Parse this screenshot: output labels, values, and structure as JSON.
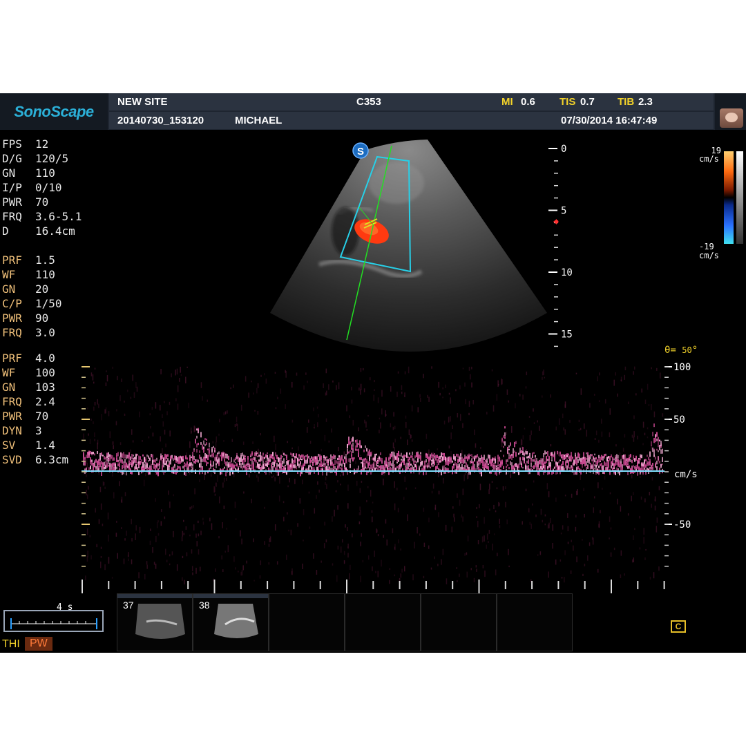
{
  "header": {
    "brand": "SonoScape",
    "site": "NEW SITE",
    "probe": "C353",
    "mi_label": "MI",
    "mi_value": "0.6",
    "tis_label": "TIS",
    "tis_value": "0.7",
    "tib_label": "TIB",
    "tib_value": "2.3",
    "exam_id": "20140730_153120",
    "patient": "MICHAEL",
    "datetime": "07/30/2014 16:47:49"
  },
  "params_bmode": [
    {
      "k": "FPS",
      "v": "12"
    },
    {
      "k": "D/G",
      "v": "120/5"
    },
    {
      "k": "GN",
      "v": "110"
    },
    {
      "k": "I/P",
      "v": "0/10"
    },
    {
      "k": "PWR",
      "v": "70"
    },
    {
      "k": "FRQ",
      "v": "3.6-5.1"
    },
    {
      "k": "D",
      "v": "16.4cm"
    }
  ],
  "params_color": [
    {
      "k": "PRF",
      "v": "1.5"
    },
    {
      "k": "WF",
      "v": "110"
    },
    {
      "k": "GN",
      "v": "20"
    },
    {
      "k": "C/P",
      "v": "1/50"
    },
    {
      "k": "PWR",
      "v": "90"
    },
    {
      "k": "FRQ",
      "v": "3.0"
    }
  ],
  "params_pw": [
    {
      "k": "PRF",
      "v": "4.0"
    },
    {
      "k": "WF",
      "v": "100"
    },
    {
      "k": "GN",
      "v": "103"
    },
    {
      "k": "FRQ",
      "v": "2.4"
    },
    {
      "k": "PWR",
      "v": "70"
    },
    {
      "k": "DYN",
      "v": "3"
    },
    {
      "k": "SV",
      "v": "1.4"
    },
    {
      "k": "SVD",
      "v": "6.3cm"
    }
  ],
  "depth_scale": [
    "0",
    "5",
    "10",
    "15"
  ],
  "color_scale": {
    "top": "19",
    "bottom": "-19",
    "unit": "cm/s"
  },
  "angle": {
    "label": "θ=",
    "value": "50",
    "unit": "°"
  },
  "doppler_scale": {
    "labels": [
      "100",
      "50",
      "cm/s",
      "-50"
    ]
  },
  "sweep": {
    "label": "4 s"
  },
  "thumbnails": [
    "37",
    "38"
  ],
  "modes": {
    "thi": "THI",
    "pw": "PW"
  },
  "colors": {
    "header_bg": "#2b3340",
    "accent_yellow": "#f2d22a",
    "param_orange": "#f0c07a",
    "baseline_cyan": "#7fe0ff",
    "doppler_pink": "#e070b0",
    "color_box": "#27d0e8"
  }
}
